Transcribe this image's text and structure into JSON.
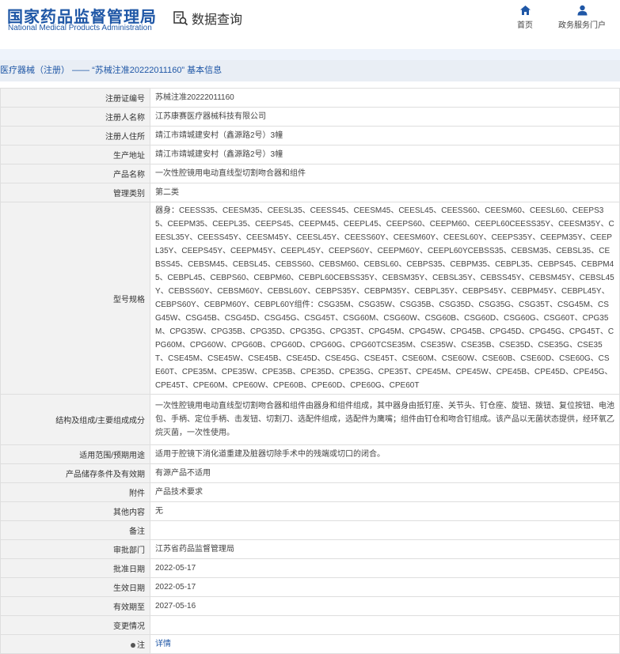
{
  "header": {
    "logo_cn": "国家药品监督管理局",
    "logo_en": "National Medical Products Administration",
    "query_title": "数据查询",
    "nav_home": "首页",
    "nav_portal": "政务服务门户"
  },
  "breadcrumb": "医疗器械（注册） —— “苏械注准20222011160” 基本信息",
  "rows": [
    {
      "label": "注册证编号",
      "value": "苏械注准20222011160"
    },
    {
      "label": "注册人名称",
      "value": "江苏康赛医疗器械科技有限公司"
    },
    {
      "label": "注册人住所",
      "value": "靖江市靖城建安村（鑫源路2号）3幢"
    },
    {
      "label": "生产地址",
      "value": "靖江市靖城建安村（鑫源路2号）3幢"
    },
    {
      "label": "产品名称",
      "value": "一次性腔镜用电动直线型切割吻合器和组件"
    },
    {
      "label": "管理类别",
      "value": "第二类"
    },
    {
      "label": "型号规格",
      "value": "器身：CEESS35、CEESM35、CEESL35、CEESS45、CEESM45、CEESL45、CEESS60、CEESM60、CEESL60、CEEPS35、CEEPM35、CEEPL35、CEEPS45、CEEPM45、CEEPL45、CEEPS60、CEEPM60、CEEPL60CEESS35Y、CEESM35Y、CEESL35Y、CEESS45Y、CEESM45Y、CEESL45Y、CEESS60Y、CEESM60Y、CEESL60Y、CEEPS35Y、CEEPM35Y、CEEPL35Y、CEEPS45Y、CEEPM45Y、CEEPL45Y、CEEPS60Y、CEEPM60Y、CEEPL60YCEBSS35、CEBSM35、CEBSL35、CEBSS45、CEBSM45、CEBSL45、CEBSS60、CEBSM60、CEBSL60、CEBPS35、CEBPM35、CEBPL35、CEBPS45、CEBPM45、CEBPL45、CEBPS60、CEBPM60、CEBPL60CEBSS35Y、CEBSM35Y、CEBSL35Y、CEBSS45Y、CEBSM45Y、CEBSL45Y、CEBSS60Y、CEBSM60Y、CEBSL60Y、CEBPS35Y、CEBPM35Y、CEBPL35Y、CEBPS45Y、CEBPM45Y、CEBPL45Y、CEBPS60Y、CEBPM60Y、CEBPL60Y组件：CSG35M、CSG35W、CSG35B、CSG35D、CSG35G、CSG35T、CSG45M、CSG45W、CSG45B、CSG45D、CSG45G、CSG45T、CSG60M、CSG60W、CSG60B、CSG60D、CSG60G、CSG60T、CPG35M、CPG35W、CPG35B、CPG35D、CPG35G、CPG35T、CPG45M、CPG45W、CPG45B、CPG45D、CPG45G、CPG45T、CPG60M、CPG60W、CPG60B、CPG60D、CPG60G、CPG60TCSE35M、CSE35W、CSE35B、CSE35D、CSE35G、CSE35T、CSE45M、CSE45W、CSE45B、CSE45D、CSE45G、CSE45T、CSE60M、CSE60W、CSE60B、CSE60D、CSE60G、CSE60T、CPE35M、CPE35W、CPE35B、CPE35D、CPE35G、CPE35T、CPE45M、CPE45W、CPE45B、CPE45D、CPE45G、CPE45T、CPE60M、CPE60W、CPE60B、CPE60D、CPE60G、CPE60T"
    },
    {
      "label": "结构及组成/主要组成成分",
      "value": "一次性腔镜用电动直线型切割吻合器和组件由器身和组件组成，其中器身由抵钉座、关节头、钉仓座、旋钮、拨钮、复位按钮、电池包、手柄、定位手柄、击发钮、切割刀、选配件组成，选配件为鹰嘴；组件由钉仓和吻合钉组成。该产品以无菌状态提供，经环氧乙烷灭菌，一次性使用。"
    },
    {
      "label": "适用范围/预期用途",
      "value": "适用于腔镜下消化道重建及脏器切除手术中的残端或切口的闭合。"
    },
    {
      "label": "产品储存条件及有效期",
      "value": "有源产品不适用"
    },
    {
      "label": "附件",
      "value": "产品技术要求"
    },
    {
      "label": "其他内容",
      "value": "无"
    },
    {
      "label": "备注",
      "value": ""
    },
    {
      "label": "审批部门",
      "value": "江苏省药品监督管理局"
    },
    {
      "label": "批准日期",
      "value": "2022-05-17"
    },
    {
      "label": "生效日期",
      "value": "2022-05-17"
    },
    {
      "label": "有效期至",
      "value": "2027-05-16"
    },
    {
      "label": "变更情况",
      "value": ""
    },
    {
      "label": "注",
      "value": "详情"
    }
  ]
}
